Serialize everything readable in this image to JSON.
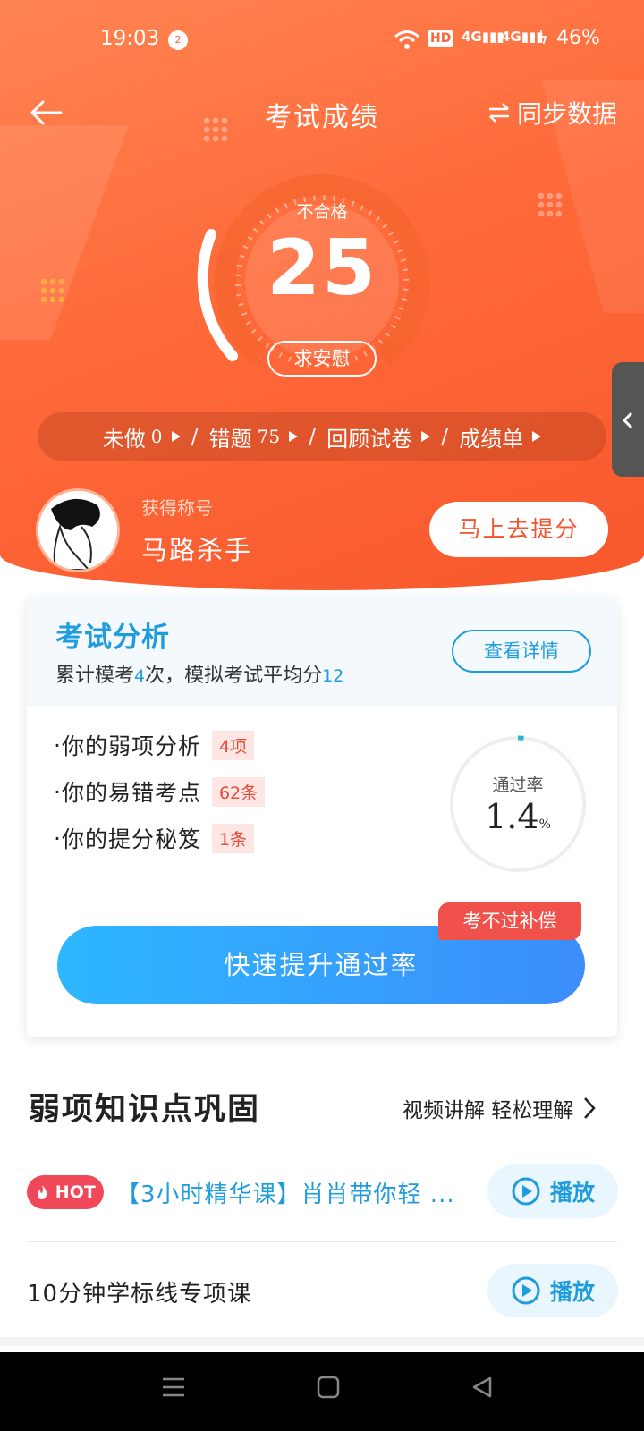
{
  "status_bar": {
    "time": "19:03",
    "notification_count": "2",
    "network": "HD 4G 4G",
    "battery": "46%"
  },
  "header": {
    "title": "考试成绩",
    "sync_label": "同步数据"
  },
  "score": {
    "status": "不合格",
    "value": "25",
    "comfort_button": "求安慰"
  },
  "stats": {
    "undone_label": "未做",
    "undone_value": "0",
    "wrong_label": "错题",
    "wrong_value": "75",
    "review_label": "回顾试卷",
    "report_label": "成绩单"
  },
  "profile": {
    "caption": "获得称号",
    "title": "马路杀手",
    "boost_button": "马上去提分"
  },
  "analysis": {
    "title": "考试分析",
    "summary_prefix": "累计模考",
    "mock_count": "4",
    "summary_mid": "次，模拟考试平均分",
    "average_score": "12",
    "detail_button": "查看详情",
    "items": [
      {
        "label": "你的弱项分析",
        "tag": "4项"
      },
      {
        "label": "你的易错考点",
        "tag": "62条"
      },
      {
        "label": "你的提分秘笈",
        "tag": "1条"
      }
    ],
    "pass_rate_label": "通过率",
    "pass_rate_value": "1.4",
    "pass_rate_unit": "%",
    "pass_rate": 0.014,
    "quick_button": "快速提升通过率",
    "compensation_badge": "考不过补偿"
  },
  "knowledge": {
    "title": "弱项知识点巩固",
    "link": "视频讲解 轻松理解",
    "courses": [
      {
        "badge": "HOT",
        "title": "【3小时精华课】肖肖带你轻 ...",
        "play": "播放"
      },
      {
        "title": "10分钟学标线专项课",
        "play": "播放"
      }
    ]
  },
  "colors": {
    "accent_orange": "#f7582c",
    "accent_blue": "#1f9cdc",
    "danger_red": "#f0524b"
  }
}
